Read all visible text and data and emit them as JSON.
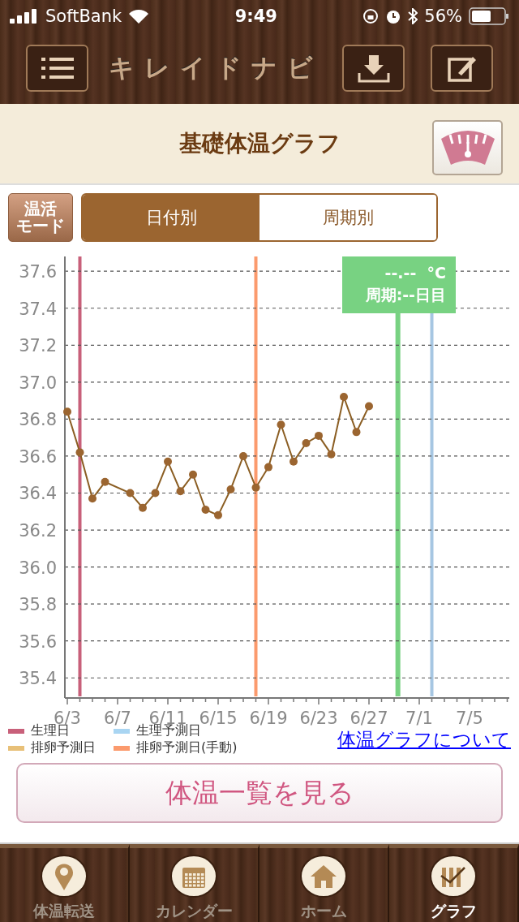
{
  "status_bar": {
    "carrier": "SoftBank",
    "time": "9:49",
    "battery": "56%"
  },
  "nav": {
    "title": "キレイドナビ"
  },
  "header": {
    "title": "基礎体温グラフ"
  },
  "mode_button": {
    "lines": [
      "温活",
      "モード"
    ]
  },
  "segments": [
    {
      "label": "日付別",
      "selected": true
    },
    {
      "label": "周期別",
      "selected": false
    }
  ],
  "chart": {
    "chart_data": {
      "type": "line",
      "categories": [
        "6/3",
        null,
        null,
        null,
        "6/7",
        null,
        null,
        null,
        "6/11",
        null,
        null,
        null,
        "6/15",
        null,
        null,
        null,
        "6/19",
        null,
        null,
        null,
        "6/23",
        null,
        null,
        null,
        "6/27",
        null,
        null,
        null,
        "7/1",
        null,
        null,
        null,
        "7/5",
        null,
        null,
        null
      ],
      "series": [
        {
          "color": "#8b5e23",
          "marker": "o",
          "values": [
            36.84,
            36.62,
            36.37,
            36.46,
            null,
            36.4,
            36.32,
            36.4,
            36.57,
            36.41,
            36.5,
            36.31,
            36.28,
            36.42,
            36.6,
            36.43,
            36.54,
            36.77,
            36.57,
            36.67,
            36.71,
            36.61,
            36.92,
            36.73,
            36.87,
            null,
            null,
            null,
            null,
            null,
            null,
            null,
            null,
            null,
            null,
            null
          ]
        }
      ],
      "ylim": [
        35.3,
        37.68
      ],
      "grid": true,
      "yticks": [
        {
          "value": 35.4,
          "label": "35.4"
        },
        {
          "value": 35.6,
          "label": "35.6"
        },
        {
          "value": 35.8,
          "label": "35.8"
        },
        {
          "value": 36.0,
          "label": "36.0"
        },
        {
          "value": 36.2,
          "label": "36.2"
        },
        {
          "value": 36.4,
          "label": "36.4"
        },
        {
          "value": 36.6,
          "label": "36.6"
        },
        {
          "value": 36.8,
          "label": "36.8"
        },
        {
          "value": 37.0,
          "label": "37.0"
        },
        {
          "value": 37.2,
          "label": "37.2"
        },
        {
          "value": 37.4,
          "label": "37.4"
        },
        {
          "value": 37.6,
          "label": "37.6"
        }
      ]
    },
    "cursor_label": {
      "temperature": "--.--  °C",
      "cycle": "周期:--日目"
    }
  },
  "legend": [
    {
      "label": "生理日",
      "color": "#c8607a"
    },
    {
      "label": "生理予測日",
      "color": "#a9d5f2"
    },
    {
      "label": "排卵予測日",
      "color": "#e8c078"
    },
    {
      "label": "排卵予測日(手動)",
      "color": "#fb9a6d"
    }
  ],
  "about_link": "体温グラフについて",
  "list_button": "体温一覧を見る",
  "tab_bar": [
    {
      "label": "体温転送",
      "kind": "pin",
      "selected": false
    },
    {
      "label": "カレンダー",
      "kind": "calendar",
      "selected": false
    },
    {
      "label": "ホーム",
      "kind": "home",
      "selected": false
    },
    {
      "label": "グラフ",
      "kind": "graph",
      "selected": true
    }
  ]
}
